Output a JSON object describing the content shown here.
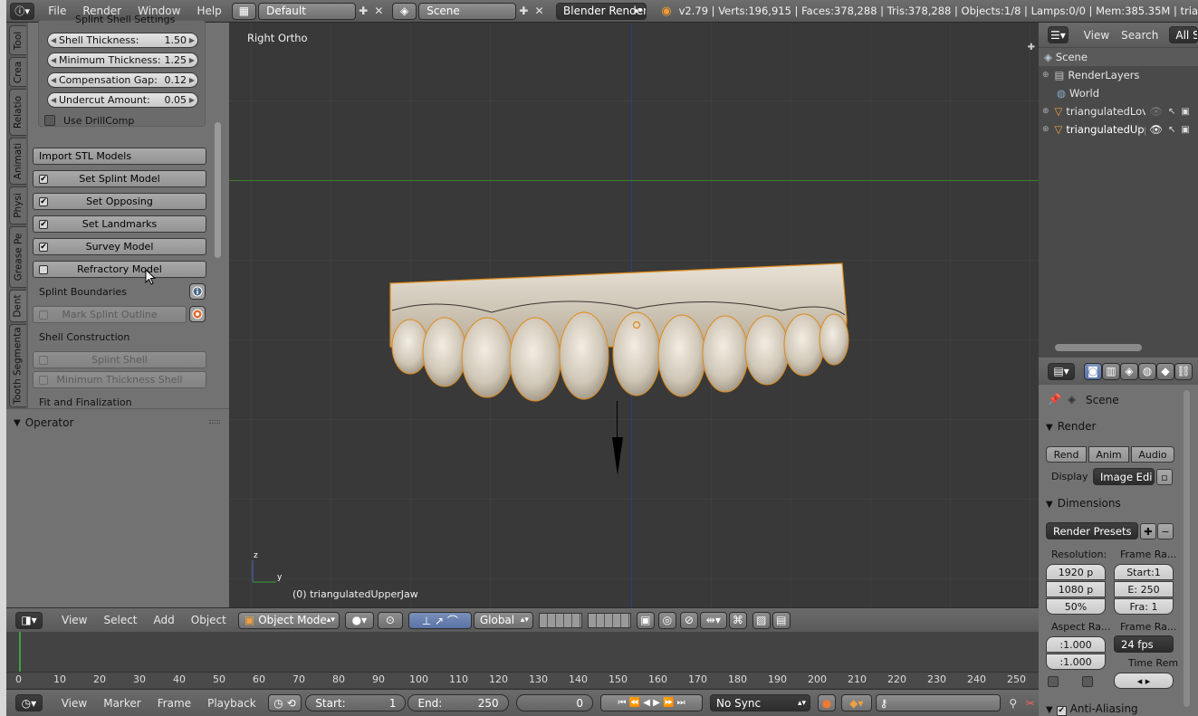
{
  "topbar": {
    "menus": [
      "File",
      "Render",
      "Window",
      "Help"
    ],
    "screen_layout": "Default",
    "scene": "Scene",
    "render_engine": "Blender Render",
    "stats": "v2.79 | Verts:196,915 | Faces:378,288 | Tris:378,288 | Objects:1/8 | Lamps:0/0 | Mem:385.35M | tria"
  },
  "toolshelf": {
    "tabs": [
      "Tool",
      "Crea",
      "Relatio",
      "Animati",
      "Physi",
      "Grease Pe",
      "Dent",
      "Tooth Segmenta"
    ],
    "cut_header": "Splint Shell Settings",
    "fields": [
      {
        "label": "Shell Thickness:",
        "value": "1.50"
      },
      {
        "label": "Minimum Thickness:",
        "value": "1.25"
      },
      {
        "label": "Compensation Gap:",
        "value": "0.12"
      },
      {
        "label": "Undercut Amount:",
        "value": "0.05"
      }
    ],
    "use_drillcomp": "Use DrillComp",
    "import_stl": "Import STL Models",
    "checks": [
      {
        "label": "Set Splint Model",
        "checked": true
      },
      {
        "label": "Set Opposing",
        "checked": true
      },
      {
        "label": "Set Landmarks",
        "checked": true
      },
      {
        "label": "Survey Model",
        "checked": true
      },
      {
        "label": "Refractory Model",
        "checked": false
      }
    ],
    "splint_boundaries": "Splint Boundaries",
    "mark_splint_outline": "Mark Splint Outline",
    "shell_construction": "Shell Construction",
    "splint_shell": "Splint Shell",
    "min_thickness_shell": "Minimum Thickness Shell",
    "fit_finalization": "Fit and Finalization",
    "operator": "Operator"
  },
  "viewport": {
    "view_name": "Right Ortho",
    "object_label": "(0) triangulatedUpperJaw",
    "axis_z": "z",
    "axis_y": "y"
  },
  "viewport_header": {
    "menus": [
      "View",
      "Select",
      "Add",
      "Object"
    ],
    "mode": "Object Mode",
    "orientation": "Global"
  },
  "timeline": {
    "ticks": [
      "0",
      "10",
      "20",
      "30",
      "40",
      "50",
      "60",
      "70",
      "80",
      "90",
      "100",
      "110",
      "120",
      "130",
      "140",
      "150",
      "160",
      "170",
      "180",
      "190",
      "200",
      "210",
      "220",
      "230",
      "240",
      "250"
    ],
    "menus": [
      "View",
      "Marker",
      "Frame",
      "Playback"
    ],
    "start_label": "Start:",
    "start": "1",
    "end_label": "End:",
    "end": "250",
    "current": "0",
    "sync": "No Sync"
  },
  "outliner": {
    "menus": [
      "View",
      "Search"
    ],
    "filter": "All S",
    "items": [
      "Scene",
      "RenderLayers",
      "World",
      "triangulatedLov",
      "triangulatedUpp"
    ]
  },
  "properties": {
    "context": "Scene",
    "render_header": "Render",
    "render_buttons": [
      "Rend",
      "Anim",
      "Audio"
    ],
    "display_label": "Display",
    "display_value": "Image Edi",
    "dimensions_header": "Dimensions",
    "presets": "Render Presets",
    "resolution_label": "Resolution:",
    "res_x": "1920 p",
    "res_y": "1080 p",
    "res_pct": "50%",
    "frame_range_label": "Frame Ra...",
    "start": "Start:1",
    "end": "E: 250",
    "frame": "Fra: 1",
    "aspect_label": "Aspect Ra...",
    "aspect_x": ":1.000",
    "aspect_y": ":1.000",
    "frame_rate_label": "Frame Ra...",
    "fps": "24 fps",
    "time_rem_label": "Time Rem",
    "anti_aliasing": "Anti-Aliasing"
  }
}
